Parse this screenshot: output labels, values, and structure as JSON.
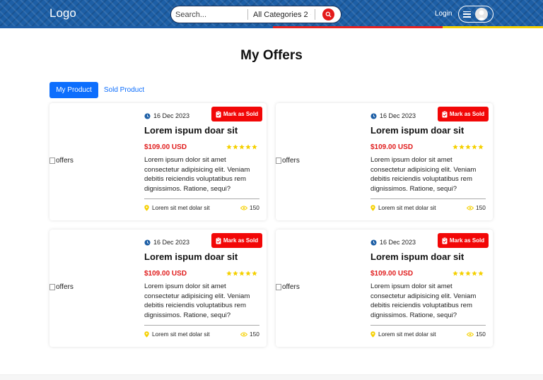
{
  "header": {
    "logo": "Logo",
    "search": {
      "placeholder": "Search..."
    },
    "category": {
      "selected": "All Categories 2"
    },
    "login_label": "Login"
  },
  "page": {
    "title": "My Offers"
  },
  "tabs": [
    {
      "label": "My Product",
      "active": true
    },
    {
      "label": "Sold Product",
      "active": false
    }
  ],
  "offers": [
    {
      "img_alt": "offers",
      "date": "16 Dec 2023",
      "mark_label": "Mark as Sold",
      "title": "Lorem ispum doar sit",
      "price": "$109.00 USD",
      "rating": 5,
      "description": "Lorem ipsum dolor sit amet consectetur adipisicing elit. Veniam debitis reiciendis voluptatibus rem dignissimos. Ratione, sequi?",
      "location": "Lorem sit met dolar sit",
      "views": "150"
    },
    {
      "img_alt": "offers",
      "date": "16 Dec 2023",
      "mark_label": "Mark as Sold",
      "title": "Lorem ispum doar sit",
      "price": "$109.00 USD",
      "rating": 5,
      "description": "Lorem ipsum dolor sit amet consectetur adipisicing elit. Veniam debitis reiciendis voluptatibus rem dignissimos. Ratione, sequi?",
      "location": "Lorem sit met dolar sit",
      "views": "150"
    },
    {
      "img_alt": "offers",
      "date": "16 Dec 2023",
      "mark_label": "Mark as Sold",
      "title": "Lorem ispum doar sit",
      "price": "$109.00 USD",
      "rating": 5,
      "description": "Lorem ipsum dolor sit amet consectetur adipisicing elit. Veniam debitis reiciendis voluptatibus rem dignissimos. Ratione, sequi?",
      "location": "Lorem sit met dolar sit",
      "views": "150"
    },
    {
      "img_alt": "offers",
      "date": "16 Dec 2023",
      "mark_label": "Mark as Sold",
      "title": "Lorem ispum doar sit",
      "price": "$109.00 USD",
      "rating": 5,
      "description": "Lorem ipsum dolor sit amet consectetur adipisicing elit. Veniam debitis reiciendis voluptatibus rem dignissimos. Ratione, sequi?",
      "location": "Lorem sit met dolar sit",
      "views": "150"
    }
  ],
  "colors": {
    "brand_blue": "#1d5fa6",
    "primary": "#0d6efd",
    "danger": "#f20707",
    "price_red": "#e01b1b",
    "star": "#f5d000",
    "accent_yellow": "#f5d000"
  },
  "icons": {
    "date": "clock-icon",
    "mark": "clipboard-check-icon",
    "location": "map-pin-icon",
    "views": "eye-icon",
    "search": "search-icon",
    "menu": "hamburger-icon",
    "avatar": "user-avatar-icon"
  }
}
